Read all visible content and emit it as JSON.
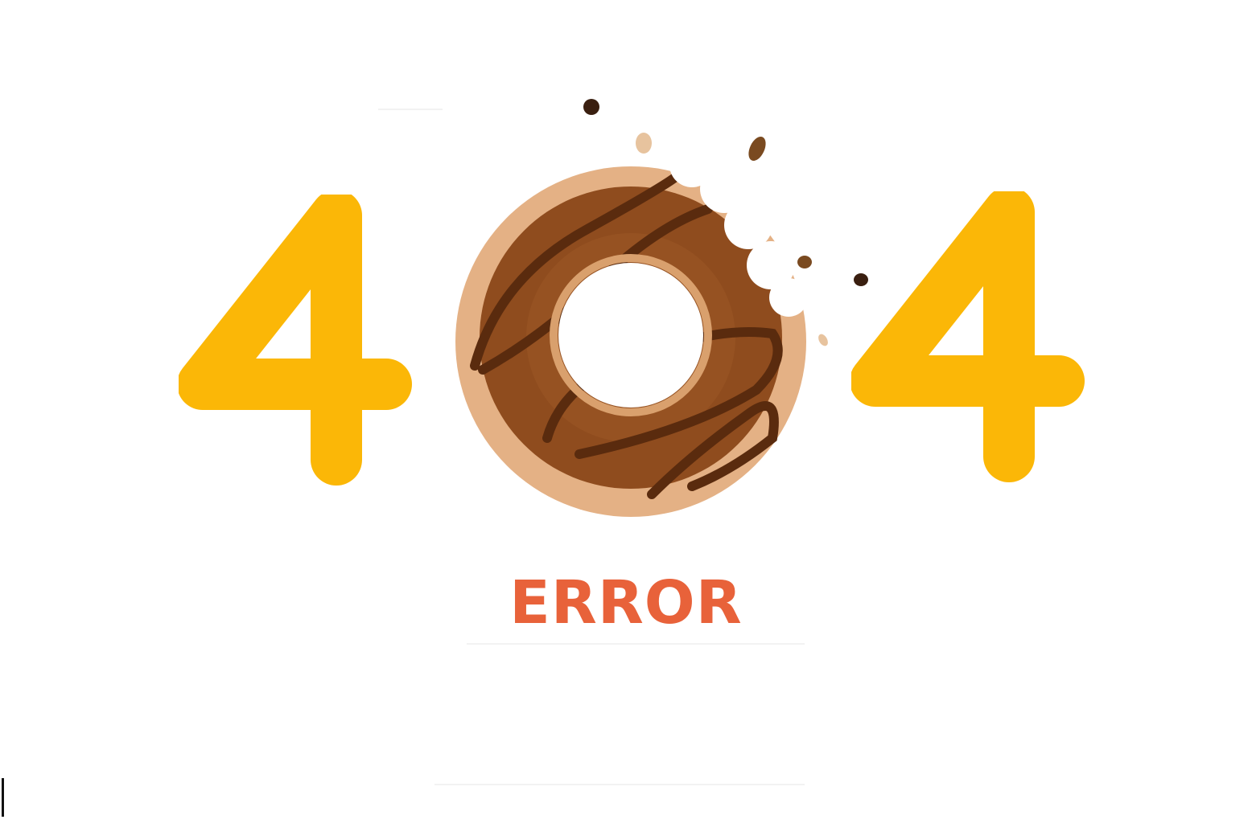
{
  "page": {
    "error_code_digit_left": "4",
    "error_code_digit_right": "4",
    "error_label": "ERROR"
  },
  "colors": {
    "digit": "#fbb707",
    "error_text": "#e8623a",
    "donut_dough": "#e4b185",
    "donut_icing": "#8b4a1c",
    "drizzle": "#5a2b0e",
    "background": "#ffffff"
  },
  "illustration": {
    "center_glyph": "bitten-donut-icon",
    "crumbs": "crumb-icon"
  }
}
